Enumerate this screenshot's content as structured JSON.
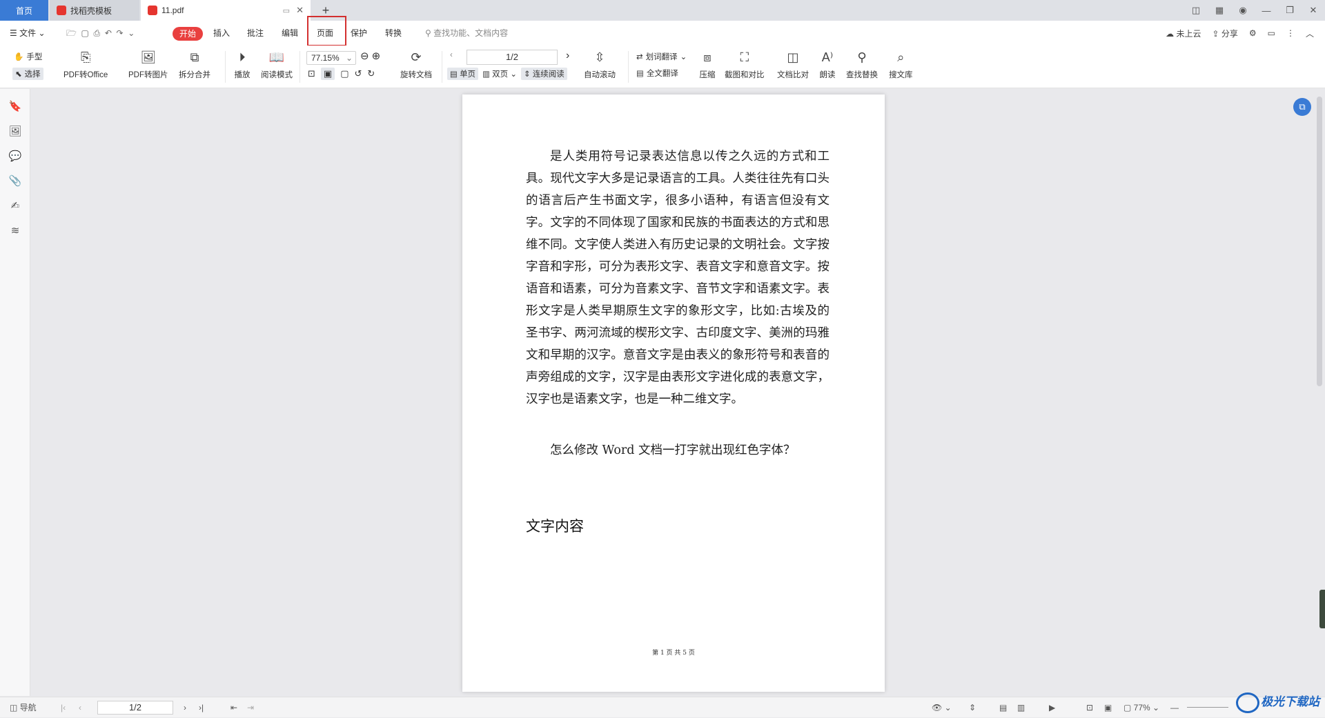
{
  "tabs": {
    "home": "首页",
    "template": "找稻壳模板",
    "file": "11.pdf"
  },
  "menu": {
    "file": "文件",
    "start": "开始",
    "insert": "插入",
    "annotate": "批注",
    "edit": "编辑",
    "page": "页面",
    "protect": "保护",
    "convert": "转换",
    "search_placeholder": "查找功能、文档内容",
    "cloud": "未上云",
    "share": "分享"
  },
  "ribbon": {
    "hand": "手型",
    "select": "选择",
    "pdf_to_office": "PDF转Office",
    "pdf_to_image": "PDF转图片",
    "split_merge": "拆分合并",
    "play": "播放",
    "read_mode": "阅读模式",
    "zoom": "77.15%",
    "rotate_doc": "旋转文档",
    "page_indicator": "1/2",
    "single": "单页",
    "double": "双页",
    "continuous": "连续阅读",
    "auto_scroll": "自动滚动",
    "word_translate": "划词翻译",
    "full_translate": "全文翻译",
    "compress": "压缩",
    "screenshot_compare": "截图和对比",
    "doc_compare": "文档比对",
    "read_aloud": "朗读",
    "find_replace": "查找替换",
    "search_lib": "搜文库"
  },
  "document": {
    "para1": "是人类用符号记录表达信息以传之久远的方式和工具。现代文字大多是记录语言的工具。人类往往先有口头的语言后产生书面文字，很多小语种，有语言但没有文字。文字的不同体现了国家和民族的书面表达的方式和思维不同。文字使人类进入有历史记录的文明社会。文字按字音和字形，可分为表形文字、表音文字和意音文字。按语音和语素，可分为音素文字、音节文字和语素文字。表形文字是人类早期原生文字的象形文字，比如:古埃及的圣书字、两河流域的楔形文字、古印度文字、美洲的玛雅文和早期的汉字。意音文字是由表义的象形符号和表音的声旁组成的文字，汉字是由表形文字进化成的表意文字，汉字也是语素文字，也是一种二维文字。",
    "para2": "怎么修改 Word 文档一打字就出现红色字体？",
    "heading": "文字内容",
    "footer": "第 1 页 共 5 页"
  },
  "statusbar": {
    "nav": "导航",
    "page": "1/2",
    "zoom": "77%"
  },
  "watermark": "极光下载站",
  "colors": {
    "accent_blue": "#3a7bd5",
    "start_red": "#e9403f",
    "highlight_box": "#d32f2f"
  }
}
